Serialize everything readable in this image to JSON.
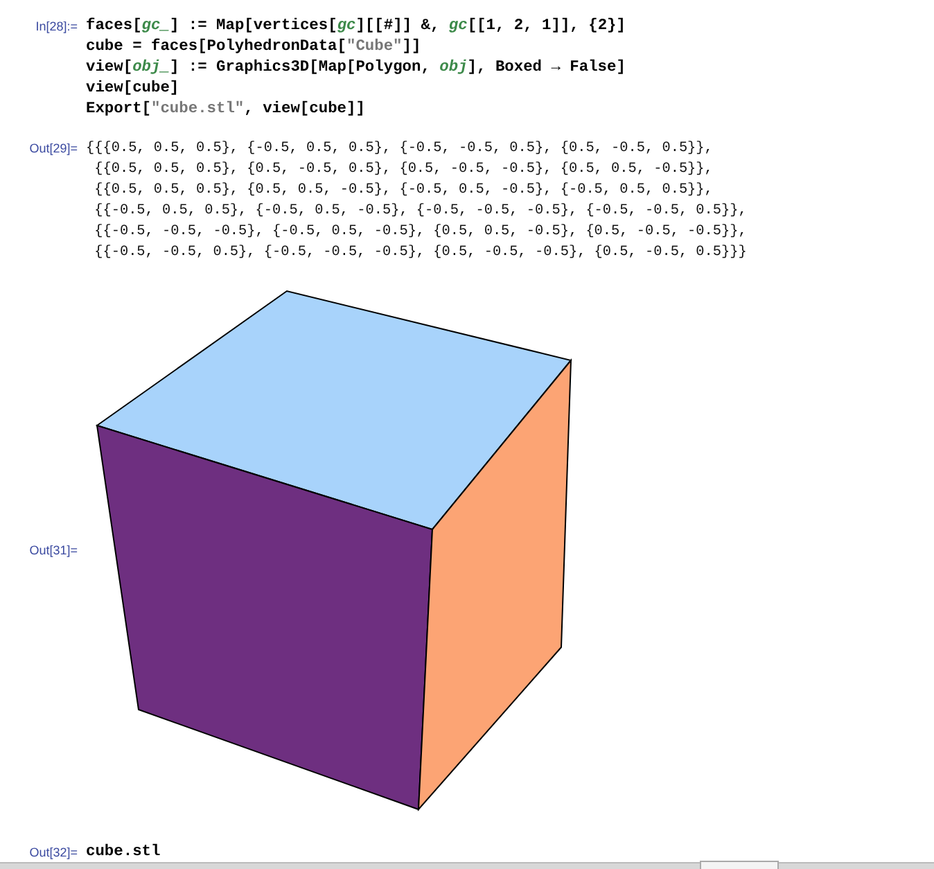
{
  "cells": [
    {
      "kind": "input",
      "label": "In[28]:=",
      "lines": [
        [
          {
            "kind": "plain",
            "text": "faces["
          },
          {
            "kind": "var",
            "text": "gc_"
          },
          {
            "kind": "plain",
            "text": "] := Map[vertices["
          },
          {
            "kind": "var",
            "text": "gc"
          },
          {
            "kind": "plain",
            "text": "][[#]] &, "
          },
          {
            "kind": "var",
            "text": "gc"
          },
          {
            "kind": "plain",
            "text": "[[1, 2, 1]], {2}]"
          }
        ],
        [
          {
            "kind": "plain",
            "text": "cube = faces[PolyhedronData["
          },
          {
            "kind": "string",
            "text": "\"Cube\""
          },
          {
            "kind": "plain",
            "text": "]]"
          }
        ],
        [
          {
            "kind": "plain",
            "text": "view["
          },
          {
            "kind": "var",
            "text": "obj_"
          },
          {
            "kind": "plain",
            "text": "] := Graphics3D[Map[Polygon, "
          },
          {
            "kind": "var",
            "text": "obj"
          },
          {
            "kind": "plain",
            "text": "], Boxed → False]"
          }
        ],
        [
          {
            "kind": "plain",
            "text": "view[cube]"
          }
        ],
        [
          {
            "kind": "plain",
            "text": "Export["
          },
          {
            "kind": "string",
            "text": "\"cube.stl\""
          },
          {
            "kind": "plain",
            "text": ", view[cube]]"
          }
        ]
      ]
    },
    {
      "kind": "output",
      "label": "Out[29]=",
      "lines": [
        "{{{0.5, 0.5, 0.5}, {-0.5, 0.5, 0.5}, {-0.5, -0.5, 0.5}, {0.5, -0.5, 0.5}},",
        " {{0.5, 0.5, 0.5}, {0.5, -0.5, 0.5}, {0.5, -0.5, -0.5}, {0.5, 0.5, -0.5}},",
        " {{0.5, 0.5, 0.5}, {0.5, 0.5, -0.5}, {-0.5, 0.5, -0.5}, {-0.5, 0.5, 0.5}},",
        " {{-0.5, 0.5, 0.5}, {-0.5, 0.5, -0.5}, {-0.5, -0.5, -0.5}, {-0.5, -0.5, 0.5}},",
        " {{-0.5, -0.5, -0.5}, {-0.5, 0.5, -0.5}, {0.5, 0.5, -0.5}, {0.5, -0.5, -0.5}},",
        " {{-0.5, -0.5, 0.5}, {-0.5, -0.5, -0.5}, {0.5, -0.5, -0.5}, {0.5, -0.5, 0.5}}}"
      ]
    },
    {
      "kind": "graphics",
      "label": "Out[31]="
    },
    {
      "kind": "result",
      "label": "Out[32]=",
      "lines": [
        "cube.stl"
      ]
    }
  ]
}
